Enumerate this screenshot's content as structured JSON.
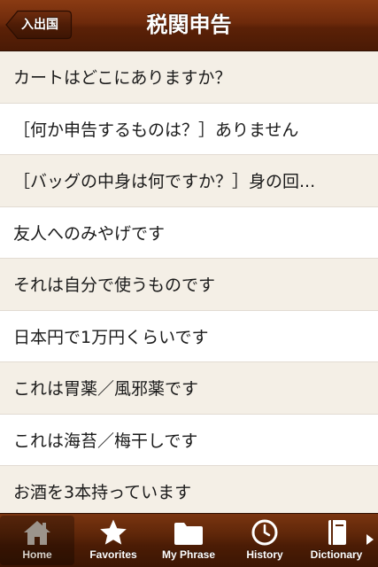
{
  "nav": {
    "back_label": "入出国",
    "title": "税関申告"
  },
  "rows": [
    "カートはどこにありますか？",
    "［何か申告するものは？］ありません",
    "［バッグの中身は何ですか？］身の回...",
    "友人へのみやげです",
    "それは自分で使うものです",
    "日本円で1万円くらいです",
    "これは胃薬／風邪薬です",
    "これは海苔／梅干しです",
    "お酒を3本持っています"
  ],
  "tabs": {
    "home": "Home",
    "favorites": "Favorites",
    "my_phrase": "My Phrase",
    "history": "History",
    "dictionary": "Dictionary"
  },
  "colors": {
    "bar_brown": "#5e2609",
    "row_alt": "#f4efe6"
  }
}
